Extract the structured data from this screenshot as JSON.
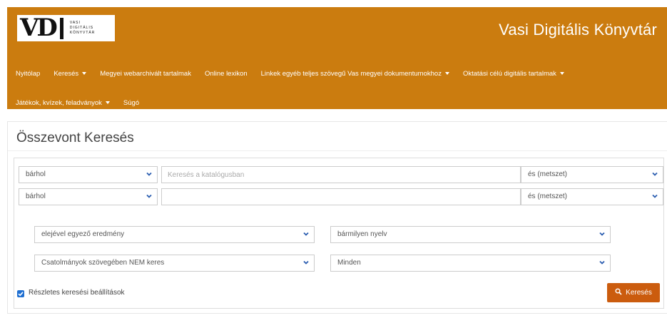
{
  "header": {
    "logo_text": [
      "VASI",
      "DIGITÁLIS",
      "KÖNYVTÁR"
    ],
    "site_title": "Vasi Digitális Könyvtár",
    "nav_rows": [
      [
        {
          "label": "Nyitólap",
          "dropdown": false
        },
        {
          "label": "Keresés",
          "dropdown": true
        },
        {
          "label": "Megyei webarchivált tartalmak",
          "dropdown": false
        },
        {
          "label": "Online lexikon",
          "dropdown": false
        },
        {
          "label": "Linkek egyéb teljes szövegű Vas megyei dokumentumokhoz",
          "dropdown": true
        },
        {
          "label": "Oktatási célú digitális tartalmak",
          "dropdown": true
        }
      ],
      [
        {
          "label": "Játékok, kvízek, feladványok",
          "dropdown": true
        },
        {
          "label": "Súgó",
          "dropdown": false
        }
      ]
    ]
  },
  "search": {
    "title": "Összevont Keresés",
    "rows": [
      {
        "field": "bárhol",
        "query": "",
        "placeholder": "Keresés a katalógusban",
        "operator": "és (metszet)"
      },
      {
        "field": "bárhol",
        "query": "",
        "placeholder": "",
        "operator": "és (metszet)"
      }
    ],
    "advanced": {
      "match": "elejével egyező eredmény",
      "language": "bármilyen nyelv",
      "attachments": "Csatolmányok szövegében NEM keres",
      "type": "Minden"
    },
    "detailed_checkbox": {
      "label": "Részletes keresési beállítások",
      "checked": true
    },
    "submit_label": "Keresés"
  },
  "colors": {
    "header_bg": "#cb7c0f",
    "button_bg": "#cb5c0e",
    "checkbox": "#1f6fd1",
    "chevron": "#2a5db0"
  }
}
